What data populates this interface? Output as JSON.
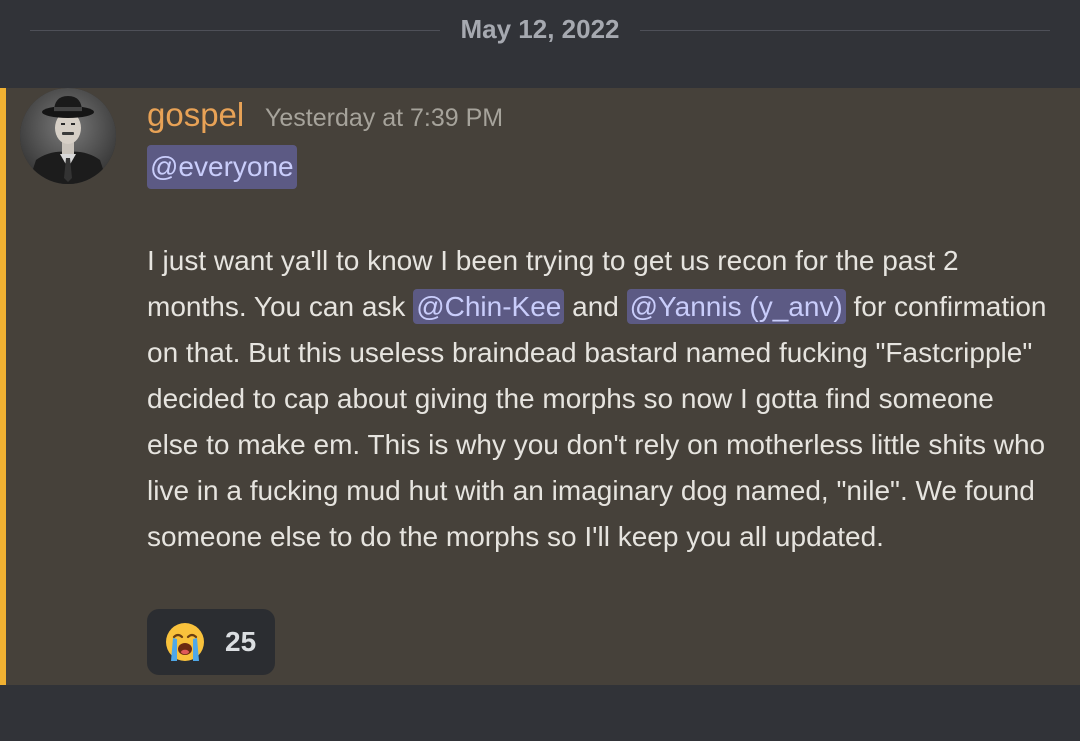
{
  "date_divider": {
    "label": "May 12, 2022"
  },
  "message": {
    "author": "gospel",
    "timestamp": "Yesterday at 7:39 PM",
    "everyone_mention": "@everyone",
    "body": {
      "part1": "I just want ya'll to know I been trying to get us recon for the past 2 months. You can ask ",
      "mention1": "@Chin-Kee",
      "part2": " and ",
      "mention2": "@Yannis (y_anv)",
      "part3": " for confirmation on that. But this useless braindead bastard named fucking \"Fastcripple\" decided to cap about giving the morphs so now I gotta find someone else to make em. This is why you don't rely on motherless little shits who live in a fucking mud hut with an imaginary dog named, \"nile\". We found someone else to do the morphs so I'll keep you all updated."
    },
    "reaction": {
      "emoji": "loudly-crying-face",
      "count": "25"
    }
  },
  "colors": {
    "background": "#313338",
    "highlight": "#46413a",
    "mention_bar": "#f0b132",
    "author": "#e8a256",
    "mention_bg": "#5c5a84",
    "mention_text": "#c9cdfb"
  }
}
